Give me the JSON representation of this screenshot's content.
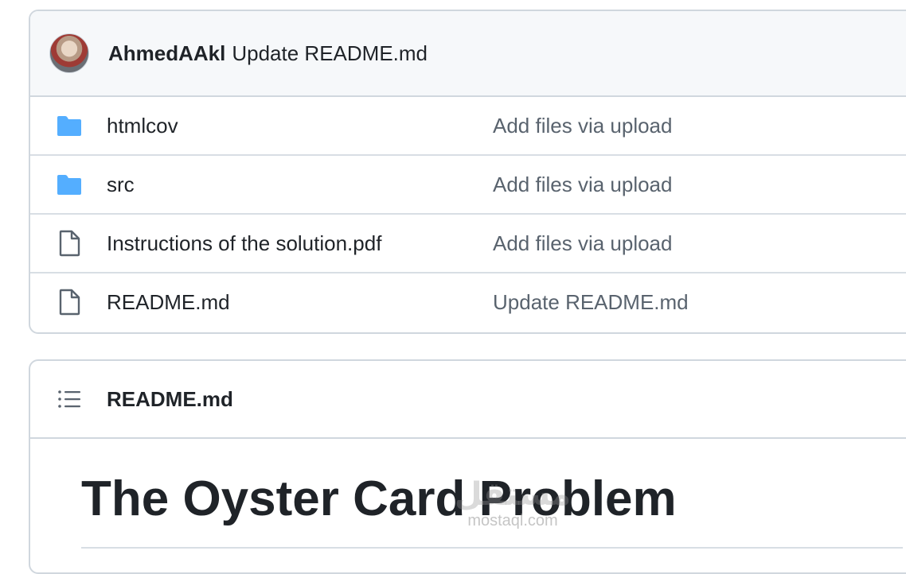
{
  "latest_commit": {
    "author": "AhmedAAkl",
    "message": "Update README.md"
  },
  "files": [
    {
      "name": "htmlcov",
      "type": "folder",
      "icon": "folder-icon",
      "commit_message": "Add files via upload"
    },
    {
      "name": "src",
      "type": "folder",
      "icon": "folder-icon",
      "commit_message": "Add files via upload"
    },
    {
      "name": "Instructions of the solution.pdf",
      "type": "file",
      "icon": "file-icon",
      "commit_message": "Add files via upload"
    },
    {
      "name": "README.md",
      "type": "file",
      "icon": "file-icon",
      "commit_message": "Update README.md"
    }
  ],
  "readme": {
    "icon": "list-icon",
    "filename": "README.md",
    "heading": "The Oyster Card Problem"
  },
  "watermark": {
    "glyph": "مستقل",
    "text": "mostaql.com"
  },
  "colors": {
    "folder": "#54aeff",
    "file_icon": "#59636e",
    "muted_text": "#59636e",
    "border": "#d0d7de"
  }
}
